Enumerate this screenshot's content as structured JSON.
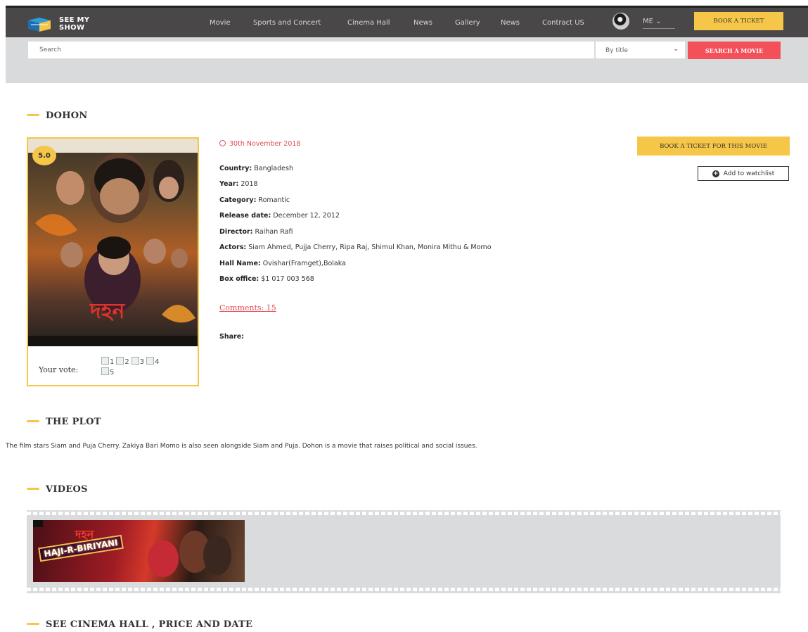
{
  "header": {
    "logo_text": "SEE MY SHOW",
    "logo_line1": "SEE MY",
    "logo_line2": "SHOW",
    "nav": [
      "Movie",
      "Sports and Concert",
      "Cinema Hall",
      "News",
      "Gallery",
      "News",
      "Contract US"
    ],
    "user_label": "ME",
    "book_ticket_label": "BOOK A TICKET"
  },
  "search": {
    "placeholder": "Search",
    "filter_selected": "By title",
    "button_label": "SEARCH A MOVIE"
  },
  "movie": {
    "title": "DOHON",
    "rating": "5.0",
    "date": "30th November 2018",
    "details": [
      {
        "label": "Country:",
        "value": "Bangladesh"
      },
      {
        "label": "Year:",
        "value": "2018"
      },
      {
        "label": "Category:",
        "value": "Romantic"
      },
      {
        "label": "Release date:",
        "value": "December 12, 2012"
      },
      {
        "label": "Director:",
        "value": "Raihan Rafi"
      },
      {
        "label": "Actors:",
        "value": "Siam Ahmed, Pujja Cherry, Ripa Raj, Shimul Khan, Monira Mithu & Momo"
      },
      {
        "label": "Hall Name:",
        "value": "Ovishar(Framget),Bolaka"
      },
      {
        "label": "Box office:",
        "value": "$1 017 003 568"
      }
    ],
    "comments_label": "Comments: 15",
    "share_label": "Share:",
    "book_movie_label": "BOOK A TICKET FOR THIS MOVIE",
    "watchlist_label": "Add to watchlist",
    "vote_label": "Your vote:",
    "vote_options": [
      "1",
      "2",
      "3",
      "4",
      "5"
    ]
  },
  "sections": {
    "plot_title": "THE PLOT",
    "plot_text": "The film stars Siam and Puja Cherry. Zakiya Bari Momo is also seen alongside Siam and Puja. Dohon is a movie that raises political and social issues.",
    "videos_title": "VIDEOS",
    "video_thumb_text": "HAJI-R-BIRIYANI",
    "cinema_title": "SEE CINEMA HALL , PRICE AND DATE"
  },
  "colors": {
    "accent_yellow": "#f6c649",
    "accent_red": "#f4505a",
    "header_bg": "#4a4749",
    "band_gray": "#d8dadc"
  }
}
